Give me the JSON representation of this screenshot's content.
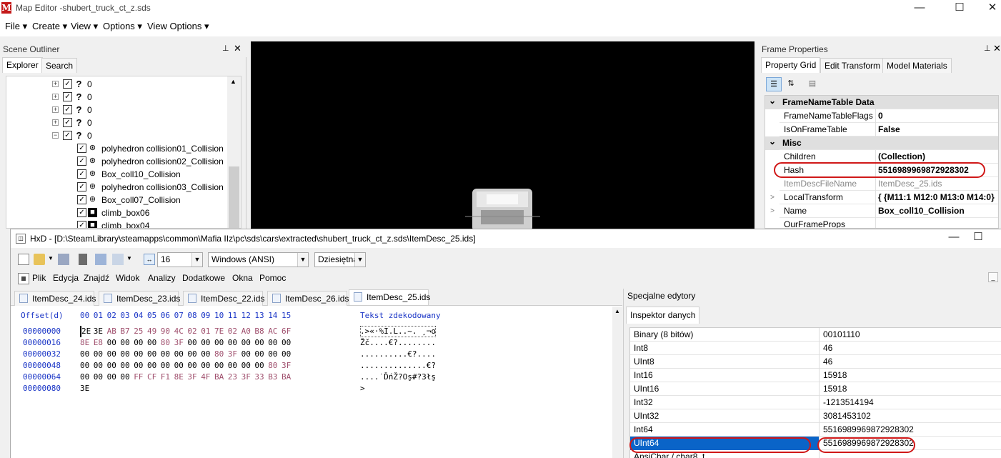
{
  "map_editor": {
    "title": "Map Editor -shubert_truck_ct_z.sds",
    "logo_text": "M",
    "window_buttons": [
      "—",
      "☐",
      "✕"
    ],
    "menu": [
      "File",
      "Create",
      "View",
      "Options",
      "View Options"
    ],
    "scene_outliner": {
      "title": "Scene Outliner",
      "tabs": [
        "Explorer",
        "Search"
      ],
      "pin_glyph": "📌",
      "close_glyph": "✕",
      "tree": [
        {
          "label": "0",
          "kind": "question",
          "expander": "+"
        },
        {
          "label": "0",
          "kind": "question",
          "expander": "+"
        },
        {
          "label": "0",
          "kind": "question",
          "expander": "+"
        },
        {
          "label": "0",
          "kind": "question",
          "expander": "+"
        },
        {
          "label": "0",
          "kind": "question",
          "expander": "−"
        },
        {
          "label": "polyhedron collision01_Collision",
          "kind": "collision"
        },
        {
          "label": "polyhedron collision02_Collision",
          "kind": "collision"
        },
        {
          "label": "Box_coll10_Collision",
          "kind": "collision"
        },
        {
          "label": "polyhedron collision03_Collision",
          "kind": "collision"
        },
        {
          "label": "Box_coll07_Collision",
          "kind": "collision"
        },
        {
          "label": "climb_box06",
          "kind": "black"
        },
        {
          "label": "climb_box04",
          "kind": "black"
        }
      ]
    },
    "frame_properties": {
      "title": "Frame Properties",
      "tabs": [
        "Property Grid",
        "Edit Transform",
        "Model Materials"
      ],
      "rows": [
        {
          "type": "category",
          "name": "FrameNameTable Data"
        },
        {
          "type": "prop",
          "name": "FrameNameTableFlags",
          "value": "0"
        },
        {
          "type": "prop",
          "name": "IsOnFrameTable",
          "value": "False"
        },
        {
          "type": "category",
          "name": "Misc"
        },
        {
          "type": "prop",
          "name": "Children",
          "value": "(Collection)"
        },
        {
          "type": "prop",
          "name": "Hash",
          "value": "5516989969872928302",
          "highlight": true
        },
        {
          "type": "prop",
          "name": "ItemDescFileName",
          "value": "ItemDesc_25.ids",
          "dim": true
        },
        {
          "type": "prop",
          "name": "LocalTransform",
          "value": "{ {M11:1 M12:0 M13:0 M14:0}",
          "expander": ">"
        },
        {
          "type": "prop",
          "name": "Name",
          "value": "Box_coll10_Collision",
          "expander": ">"
        },
        {
          "type": "prop",
          "name": "OurFrameProps",
          "value": ""
        }
      ]
    }
  },
  "hxd": {
    "title": "HxD - [D:\\SteamLibrary\\steamapps\\common\\Mafia IIz\\pc\\sds\\cars\\extracted\\shubert_truck_ct_z.sds\\ItemDesc_25.ids]",
    "window_buttons": [
      "—",
      "☐"
    ],
    "toolbar": {
      "bytes_per_row": "16",
      "encoding": "Windows (ANSI)",
      "number_base": "Dziesiętna"
    },
    "menu": [
      "Plik",
      "Edycja",
      "Znajdź",
      "Widok",
      "Analizy",
      "Dodatkowe",
      "Okna",
      "Pomoc"
    ],
    "tabs": [
      "ItemDesc_24.ids",
      "ItemDesc_23.ids",
      "ItemDesc_22.ids",
      "ItemDesc_26.ids",
      "ItemDesc_25.ids"
    ],
    "active_tab": 4,
    "hex": {
      "offset_header": "Offset(d)",
      "column_headers": [
        "00",
        "01",
        "02",
        "03",
        "04",
        "05",
        "06",
        "07",
        "08",
        "09",
        "10",
        "11",
        "12",
        "13",
        "14",
        "15"
      ],
      "decoded_header": "Tekst zdekodowany",
      "rows": [
        {
          "offset": "00000000",
          "bytes": [
            "2E",
            "3E",
            "AB",
            "B7",
            "25",
            "49",
            "90",
            "4C",
            "02",
            "01",
            "7E",
            "02",
            "A0",
            "B8",
            "AC",
            "6F"
          ],
          "text": ".>«·%I.L..~. ¸¬o"
        },
        {
          "offset": "00000016",
          "bytes": [
            "8E",
            "E8",
            "00",
            "00",
            "00",
            "00",
            "80",
            "3F",
            "00",
            "00",
            "00",
            "00",
            "00",
            "00",
            "00",
            "00"
          ],
          "text": "Žč....€?........"
        },
        {
          "offset": "00000032",
          "bytes": [
            "00",
            "00",
            "00",
            "00",
            "00",
            "00",
            "00",
            "00",
            "00",
            "00",
            "80",
            "3F",
            "00",
            "00",
            "00",
            "00"
          ],
          "text": "..........€?...."
        },
        {
          "offset": "00000048",
          "bytes": [
            "00",
            "00",
            "00",
            "00",
            "00",
            "00",
            "00",
            "00",
            "00",
            "00",
            "00",
            "00",
            "00",
            "00",
            "80",
            "3F"
          ],
          "text": "..............€?"
        },
        {
          "offset": "00000064",
          "bytes": [
            "00",
            "00",
            "00",
            "00",
            "FF",
            "CF",
            "F1",
            "8E",
            "3F",
            "4F",
            "BA",
            "23",
            "3F",
            "33",
            "B3",
            "BA"
          ],
          "text": "....˙ĎńŽ?Oş#?3łş"
        },
        {
          "offset": "00000080",
          "bytes": [
            "3E"
          ],
          "text": ">"
        }
      ]
    },
    "special_editors": {
      "title": "Specjalne edytory",
      "tab": "Inspektor danych",
      "rows": [
        {
          "name": "Binary (8 bitów)",
          "value": "00101110"
        },
        {
          "name": "Int8",
          "value": "46"
        },
        {
          "name": "UInt8",
          "value": "46"
        },
        {
          "name": "Int16",
          "value": "15918"
        },
        {
          "name": "UInt16",
          "value": "15918"
        },
        {
          "name": "Int32",
          "value": "-1213514194"
        },
        {
          "name": "UInt32",
          "value": "3081453102"
        },
        {
          "name": "Int64",
          "value": "5516989969872928302"
        },
        {
          "name": "UInt64",
          "value": "5516989969872928302",
          "selected": true,
          "highlight": true
        },
        {
          "name": "AnsiChar / char8_t",
          "value": ""
        }
      ]
    }
  },
  "colors": {
    "accent_selection": "#0a64c8",
    "highlight_ring": "#d01818",
    "offset_blue": "#1a35c6",
    "nonzero_byte": "#a0506e"
  }
}
